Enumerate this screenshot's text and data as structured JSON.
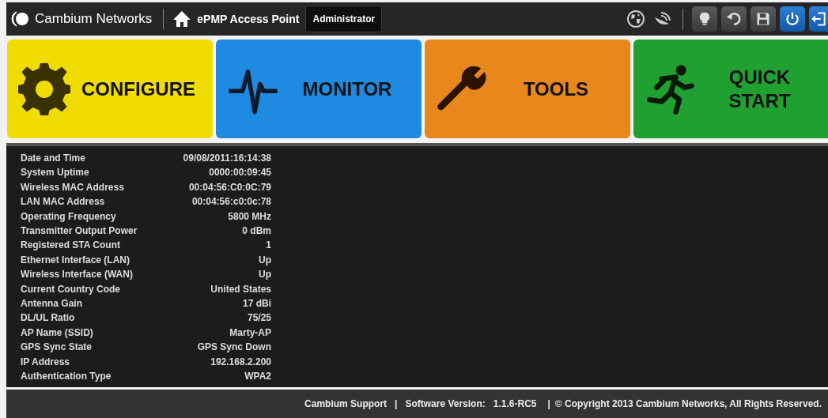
{
  "header": {
    "brand": "Cambium Networks",
    "device": "ePMP Access Point",
    "user": "Administrator"
  },
  "tiles": [
    {
      "kind": "configure",
      "label": "CONFIGURE",
      "color": "#f0dc00"
    },
    {
      "kind": "monitor",
      "label": "MONITOR",
      "color": "#1e8ae2"
    },
    {
      "kind": "tools",
      "label": "TOOLS",
      "color": "#e8871c"
    },
    {
      "kind": "quickstart",
      "label": "QUICK START",
      "color": "#21a032"
    }
  ],
  "status": [
    {
      "label": "Date and Time",
      "value": "09/08/2011:16:14:38"
    },
    {
      "label": "System Uptime",
      "value": "0000:00:09:45"
    },
    {
      "label": "Wireless MAC Address",
      "value": "00:04:56:C0:0C:79"
    },
    {
      "label": "LAN MAC Address",
      "value": "00:04:56:c0:0c:78"
    },
    {
      "label": "Operating Frequency",
      "value": "5800 MHz"
    },
    {
      "label": "Transmitter Output Power",
      "value": "0 dBm"
    },
    {
      "label": "Registered STA Count",
      "value": "1"
    },
    {
      "label": "Ethernet Interface (LAN)",
      "value": "Up"
    },
    {
      "label": "Wireless Interface (WAN)",
      "value": "Up"
    },
    {
      "label": "Current Country Code",
      "value": "United States"
    },
    {
      "label": "Antenna Gain",
      "value": "17 dBi"
    },
    {
      "label": "DL/UL Ratio",
      "value": "75/25"
    },
    {
      "label": "AP Name (SSID)",
      "value": "Marty-AP"
    },
    {
      "label": "GPS Sync State",
      "value": "GPS Sync Down"
    },
    {
      "label": "IP Address",
      "value": "192.168.2.200"
    },
    {
      "label": "Authentication Type",
      "value": "WPA2"
    }
  ],
  "footer": {
    "support": "Cambium Support",
    "separator_1": "|",
    "version_label": "Software Version:",
    "version": "1.1.6-RC5",
    "separator_2": "|",
    "copyright": "© Copyright 2013 Cambium Networks, All Rights Reserved."
  }
}
